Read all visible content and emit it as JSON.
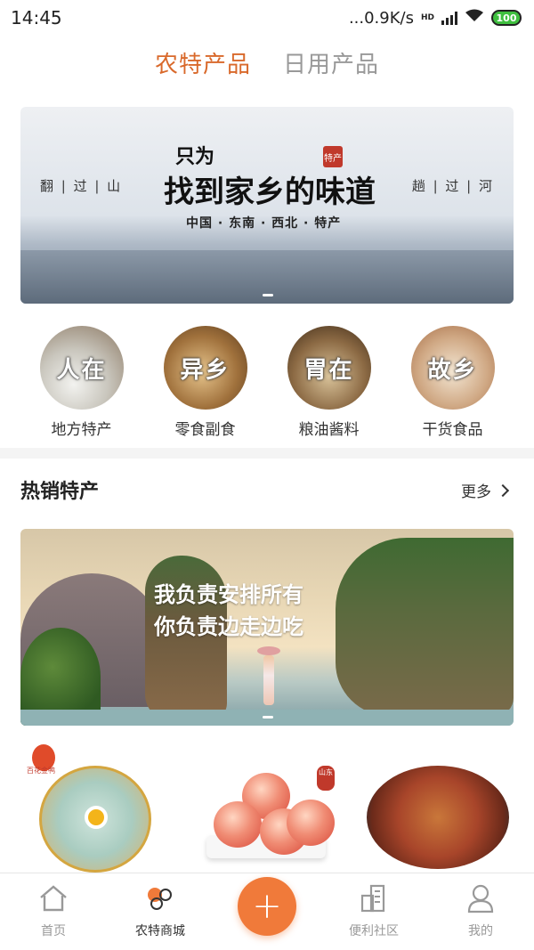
{
  "status_bar": {
    "time": "14:45",
    "network_speed": "...0.9K/s",
    "network_badge": "HD",
    "battery": "100",
    "icons": [
      "signal-icon",
      "wifi-icon",
      "battery-icon"
    ]
  },
  "top_tabs": [
    {
      "label": "农特产品",
      "active": true
    },
    {
      "label": "日用产品",
      "active": false
    }
  ],
  "hero_banner": {
    "title_small": "只为",
    "title_main": "找到家乡的味道",
    "seal_text": "特产",
    "subtitle": "中国 · 东南 · 西北 · 特产",
    "left_text": "翻 | 过 | 山",
    "right_text": "趟 | 过 | 河"
  },
  "categories": [
    {
      "label": "地方特产",
      "overlay": "人在"
    },
    {
      "label": "零食副食",
      "overlay": "异乡"
    },
    {
      "label": "粮油酱料",
      "overlay": "胃在"
    },
    {
      "label": "干货食品",
      "overlay": "故乡"
    }
  ],
  "hot_section": {
    "title": "热销特产",
    "more_label": "更多"
  },
  "promo_banner": {
    "line1": "我负责安排所有",
    "line2": "你负责边走边吃"
  },
  "product_badges": {
    "p1_brand": "百花金鸭",
    "p2_seal": "山东"
  },
  "bottom_nav": [
    {
      "label": "首页",
      "icon": "home-icon",
      "active": false
    },
    {
      "label": "农特商城",
      "icon": "farm-mall-icon",
      "active": true
    },
    {
      "label": "",
      "icon": "plus-icon",
      "active": false
    },
    {
      "label": "便利社区",
      "icon": "community-icon",
      "active": false
    },
    {
      "label": "我的",
      "icon": "profile-icon",
      "active": false
    }
  ],
  "colors": {
    "accent": "#d9692b",
    "fab": "#f07a3a",
    "inactive": "#999999"
  }
}
